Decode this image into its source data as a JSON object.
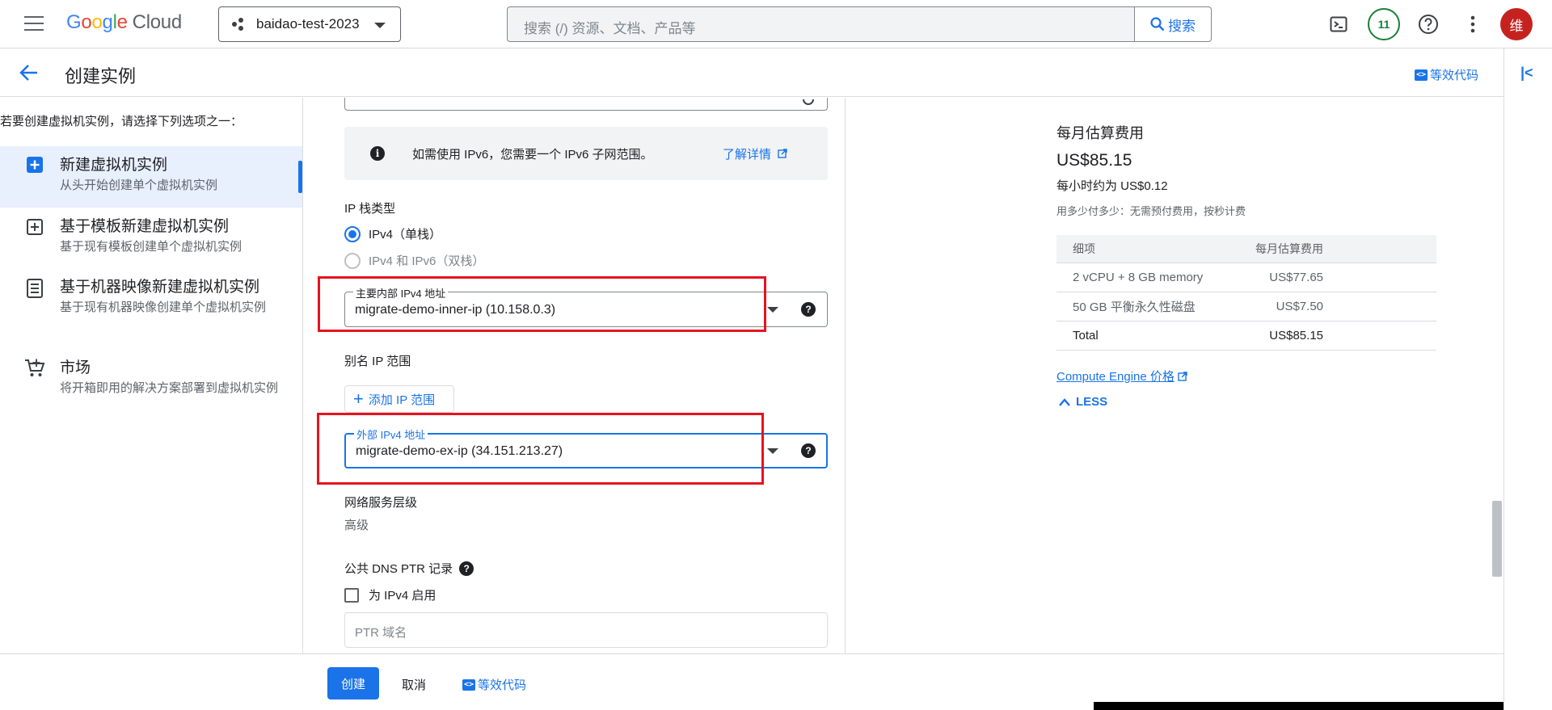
{
  "topbar": {
    "logo_parts": [
      "G",
      "o",
      "o",
      "g",
      "l",
      "e"
    ],
    "logo_suffix": "Cloud",
    "project": "baidao-test-2023",
    "search_placeholder": "搜索 (/) 资源、文档、产品等",
    "search_button": "搜索",
    "notifications_count": "11",
    "avatar_initial": "维"
  },
  "header": {
    "title": "创建实例",
    "equivalent_code": "等效代码"
  },
  "leftnav": {
    "intro": "若要创建虚拟机实例，请选择下列选项之一：",
    "items": [
      {
        "title": "新建虚拟机实例",
        "subtitle": "从头开始创建单个虚拟机实例"
      },
      {
        "title": "基于模板新建虚拟机实例",
        "subtitle": "基于现有模板创建单个虚拟机实例"
      },
      {
        "title": "基于机器映像新建虚拟机实例",
        "subtitle": "基于现有机器映像创建单个虚拟机实例"
      },
      {
        "title": "市场",
        "subtitle": "将开箱即用的解决方案部署到虚拟机实例"
      }
    ]
  },
  "form": {
    "ipv6_info": "如需使用 IPv6，您需要一个 IPv6 子网范围。",
    "learn_more": "了解详情",
    "ip_stack_label": "IP 栈类型",
    "ip_stack_options": [
      "IPv4（单栈）",
      "IPv4 和 IPv6（双栈）"
    ],
    "internal_ipv4_label": "主要内部 IPv4 地址",
    "internal_ipv4_value": "migrate-demo-inner-ip (10.158.0.3)",
    "alias_ip_label": "别名 IP 范围",
    "add_ip_range": "添加 IP 范围",
    "external_ipv4_label": "外部 IPv4 地址",
    "external_ipv4_value": "migrate-demo-ex-ip (34.151.213.27)",
    "network_tier_label": "网络服务层级",
    "network_tier_value": "高级",
    "dns_ptr_label": "公共 DNS PTR 记录",
    "enable_ipv4": "为 IPv4 启用",
    "ptr_placeholder": "PTR 域名"
  },
  "cost": {
    "title": "每月估算费用",
    "total": "US$85.15",
    "hourly": "每小时约为 US$0.12",
    "note": "用多少付多少：无需预付费用，按秒计费",
    "table_headers": [
      "细项",
      "每月估算费用"
    ],
    "rows": [
      {
        "item": "2 vCPU + 8 GB memory",
        "price": "US$77.65"
      },
      {
        "item": "50 GB 平衡永久性磁盘",
        "price": "US$7.50"
      },
      {
        "item": "Total",
        "price": "US$85.15"
      }
    ],
    "pricing_link": "Compute Engine 价格",
    "less": "LESS"
  },
  "footer": {
    "create": "创建",
    "cancel": "取消",
    "equivalent_code": "等效代码"
  },
  "colors": {
    "accent": "#1a73e8",
    "highlight_box": "#e8121f",
    "avatar": "#c5221f",
    "badge": "#188038"
  }
}
